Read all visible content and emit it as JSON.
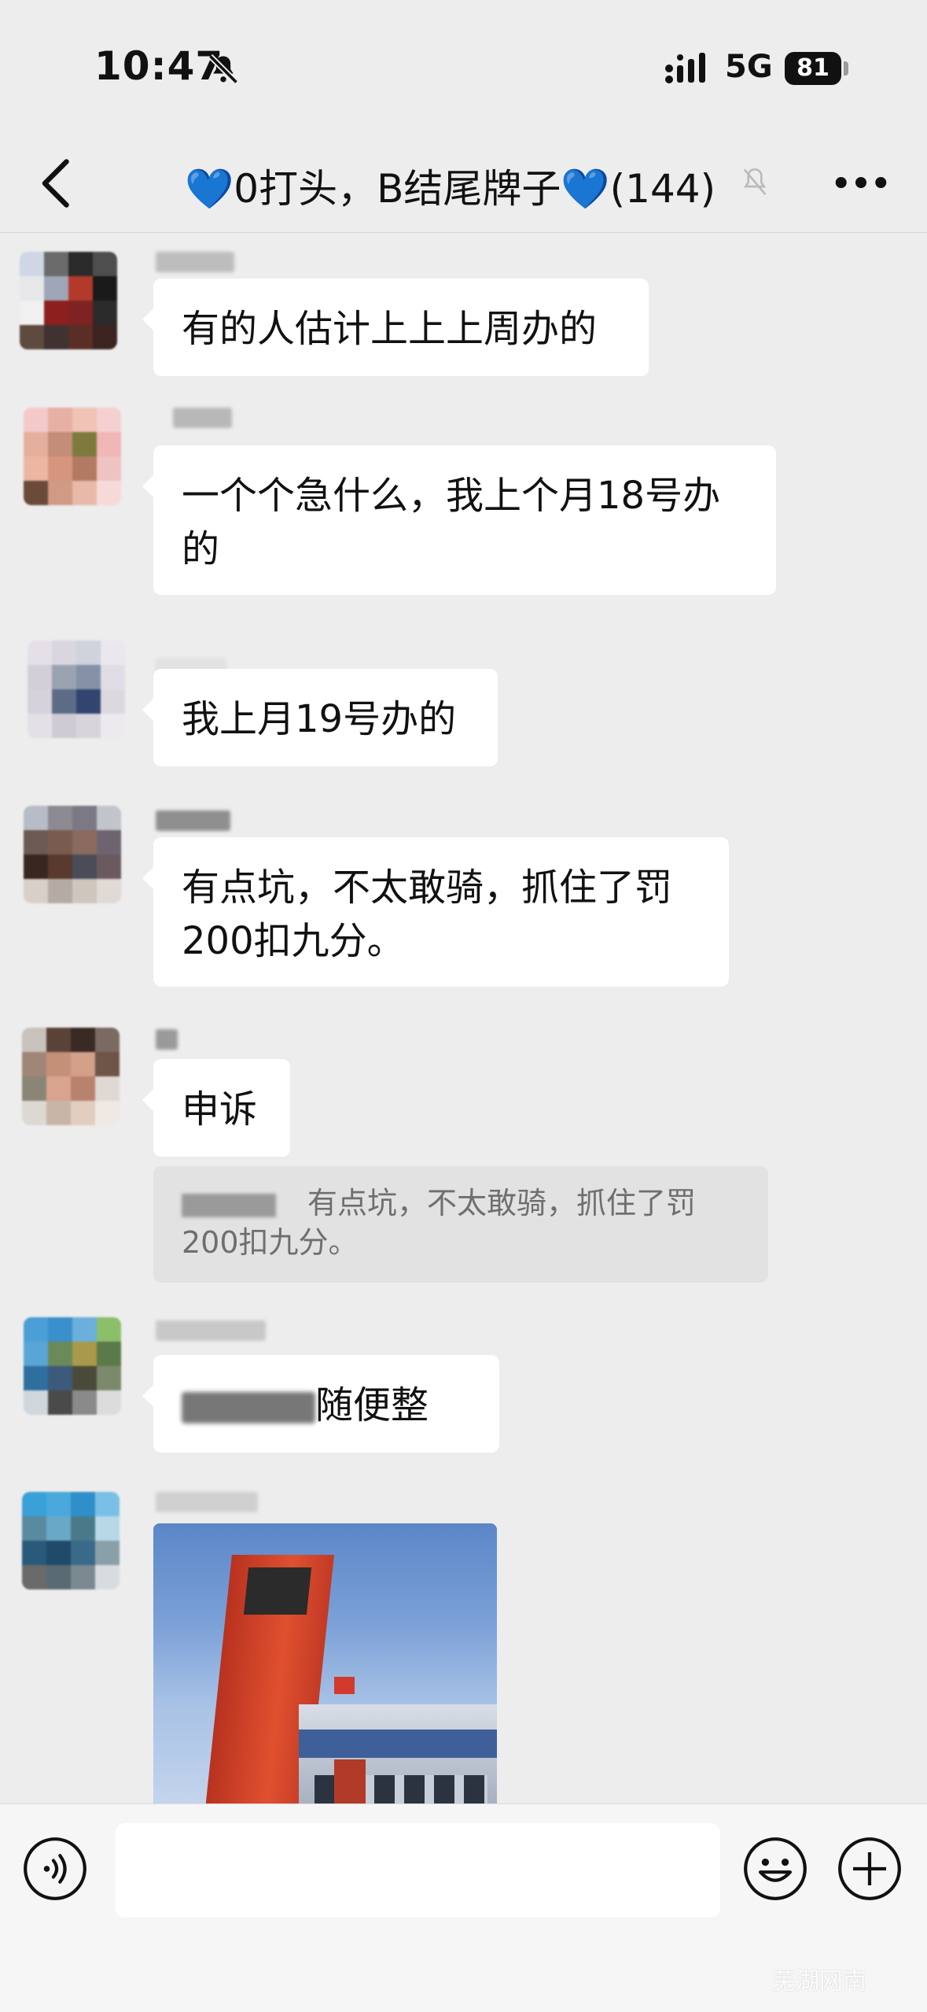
{
  "status_bar": {
    "time": "10:47",
    "network": "5G",
    "battery": "81"
  },
  "header": {
    "back_icon": "chevron-left-icon",
    "title_prefix_emoji": "💙",
    "title_text": "0打头，B结尾牌子",
    "title_suffix_emoji": "💙",
    "member_count": "(144)",
    "mute_icon": "bell-off-icon",
    "more_icon": "more-horizontal-icon"
  },
  "messages": [
    {
      "text": "有的人估计上上上周办的"
    },
    {
      "text": "一个个急什么，我上个月18号办的"
    },
    {
      "text": "我上月19号办的"
    },
    {
      "text": "有点坑，不太敢骑，抓住了罚200扣九分。"
    },
    {
      "text": "申诉",
      "quote_text": "有点坑，不太敢骑，抓住了罚200扣九分。"
    },
    {
      "text": "随便整"
    },
    {
      "image": "photo of red tower building under blue sky"
    }
  ],
  "input_bar": {
    "voice_icon": "voice-icon",
    "emoji_icon": "emoji-icon",
    "plus_icon": "plus-circle-icon",
    "input_value": ""
  },
  "watermark": "芜湖网南"
}
